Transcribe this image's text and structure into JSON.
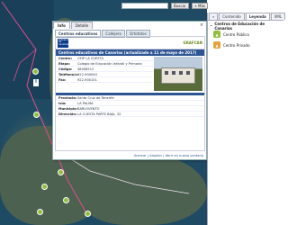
{
  "topbar": {
    "search_placeholder": "",
    "search_button": "Buscar",
    "more_button": "Más"
  },
  "popup": {
    "tabs": [
      "Info",
      "Detalle"
    ],
    "close_label": "×",
    "subtabs": [
      "Centros educativos",
      "Callejero",
      "Ortofotos"
    ],
    "logo_text": "Gobierno de Canarias",
    "brand": "GRAFCAN",
    "record_title": "Centros educativos de Canarias (actualizado a 11 de mayo de 2017)",
    "fields": [
      {
        "label": "Centro:",
        "value": "CEIP LA CUESTA"
      },
      {
        "label": "Etapa:",
        "value": "Colegio de Educación Infantil y Primaria"
      },
      {
        "label": "Código:",
        "value": "38008512"
      },
      {
        "label": "Teléfono/s:",
        "value": "922-900040"
      },
      {
        "label": "Fax:",
        "value": "922-900151"
      }
    ],
    "fields2": [
      {
        "label": "Provincia:",
        "value": "Santa Cruz de Tenerife"
      },
      {
        "label": "Isla:",
        "value": "LA PALMA"
      },
      {
        "label": "Municipio:",
        "value": "BARLOVENTO"
      },
      {
        "label": "Dirección:",
        "value": "LA CUESTA PARTE BAJA, 32"
      }
    ],
    "footer": "Acercar | Ampliar | Abrir en nueva ventana"
  },
  "sidepanel": {
    "tabs": [
      "Contenido",
      "Leyenda",
      "XML"
    ],
    "legend_title": "Centros de Educación de Canarias",
    "items": [
      {
        "label": "Centro Público",
        "color": "#8fbf3a"
      },
      {
        "label": "Centro Privado",
        "color": "#e8a13a"
      }
    ]
  }
}
